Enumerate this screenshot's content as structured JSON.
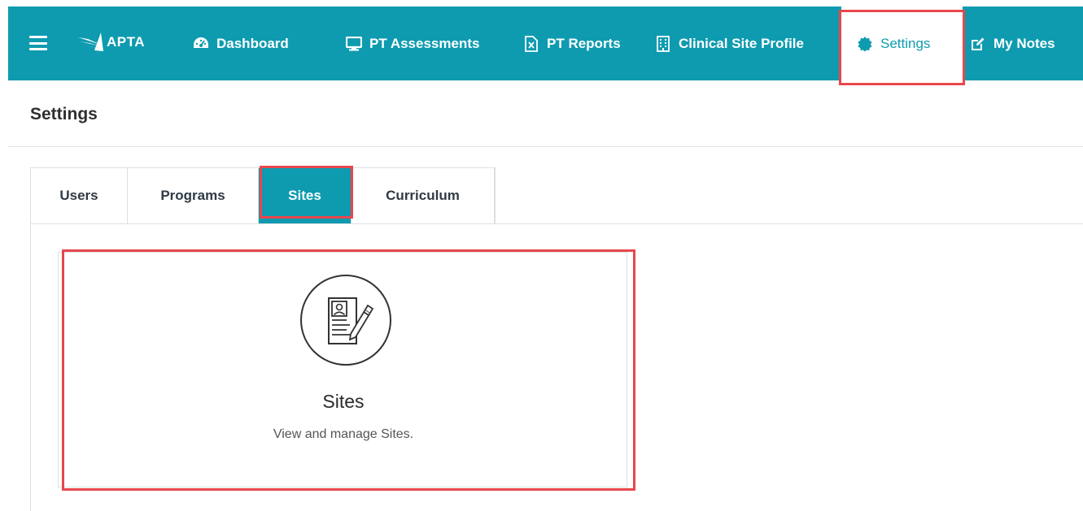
{
  "app": {
    "logo_text": "APTA",
    "accent_color": "#0e9bb0",
    "highlight_color": "#e8474c"
  },
  "nav": {
    "items": [
      {
        "label": "Dashboard",
        "icon": "tachometer-icon"
      },
      {
        "label": "PT Assessments",
        "icon": "monitor-icon"
      },
      {
        "label": "PT Reports",
        "icon": "excel-file-icon"
      },
      {
        "label": "Clinical Site Profile",
        "icon": "building-icon"
      },
      {
        "label": "Settings",
        "icon": "gear-icon",
        "active": true
      },
      {
        "label": "My Notes",
        "icon": "edit-icon"
      }
    ]
  },
  "page": {
    "title": "Settings"
  },
  "tabs": [
    {
      "label": "Users"
    },
    {
      "label": "Programs"
    },
    {
      "label": "Sites",
      "active": true
    },
    {
      "label": "Curriculum"
    }
  ],
  "card": {
    "icon": "profile-document-edit-icon",
    "title": "Sites",
    "description": "View and manage Sites."
  }
}
